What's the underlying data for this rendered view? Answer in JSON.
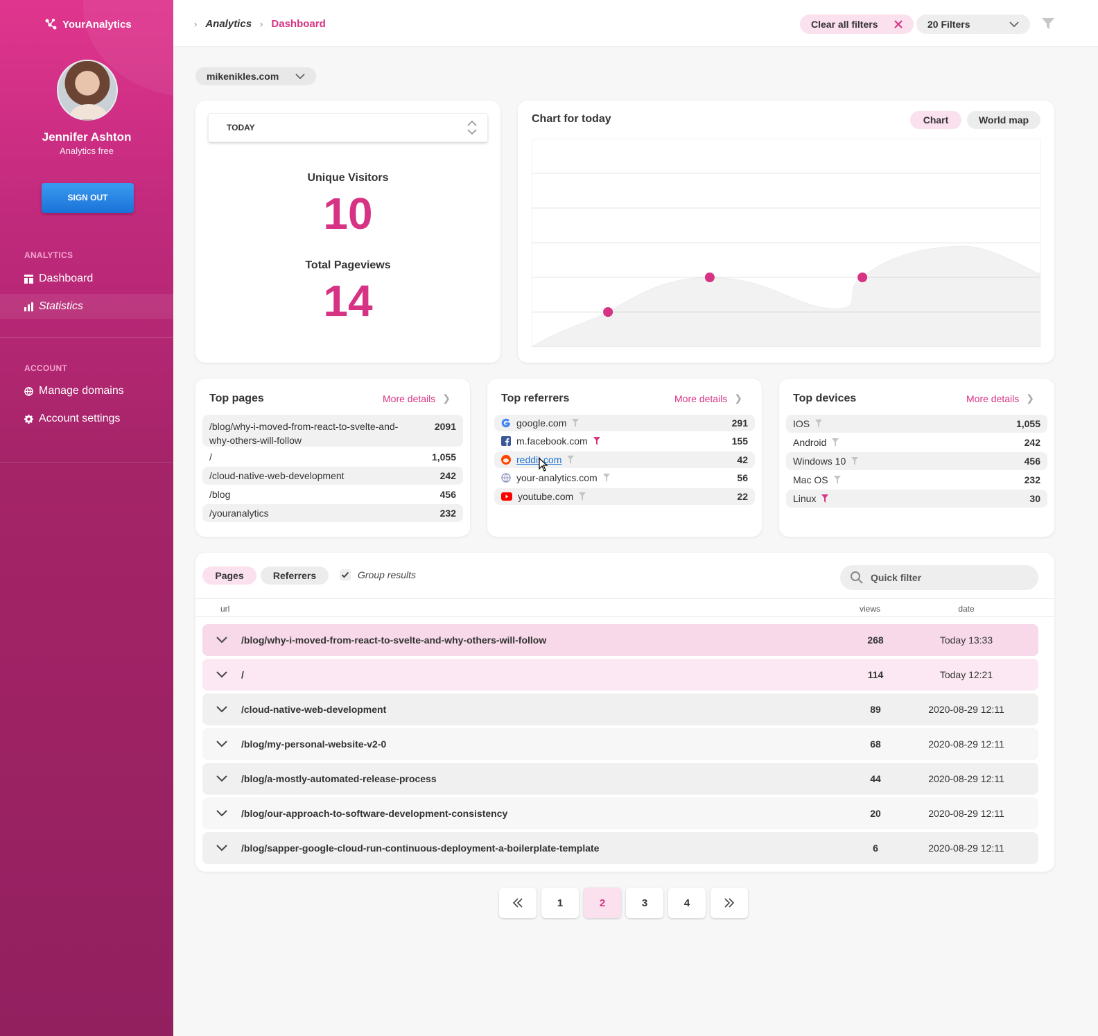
{
  "app": {
    "logo_text": "YourAnalytics"
  },
  "user": {
    "name": "Jennifer Ashton",
    "plan": "Analytics free",
    "signout_label": "SIGN OUT"
  },
  "sidebar": {
    "sections": [
      {
        "title": "ANALYTICS",
        "items": [
          {
            "label": "Dashboard",
            "icon": "dashboard-icon"
          },
          {
            "label": "Statistics",
            "icon": "bar-chart-icon",
            "active": true
          }
        ]
      },
      {
        "title": "ACCOUNT",
        "items": [
          {
            "label": "Manage domains",
            "icon": "globe-icon"
          },
          {
            "label": "Account settings",
            "icon": "gear-icon"
          }
        ]
      }
    ]
  },
  "breadcrumb": [
    "Analytics",
    "Dashboard"
  ],
  "header": {
    "clear_filters_label": "Clear all filters",
    "filters_label": "20 Filters"
  },
  "domain_select": {
    "value": "mikenikles.com"
  },
  "period_select": {
    "value": "TODAY"
  },
  "stats": {
    "unique_label": "Unique Visitors",
    "unique_value": "10",
    "pageviews_label": "Total Pageviews",
    "pageviews_value": "14"
  },
  "chart": {
    "title": "Chart for today",
    "tabs": [
      "Chart",
      "World map"
    ],
    "active_tab": "Chart"
  },
  "chart_data": {
    "type": "area",
    "points": [
      null,
      1,
      null,
      2,
      null,
      null,
      2,
      null,
      null,
      null
    ],
    "ylim": [
      0,
      6
    ],
    "grid": true
  },
  "top_pages": {
    "title": "Top pages",
    "more": "More details",
    "rows": [
      {
        "label": "/blog/why-i-moved-from-react-to-svelte-and-why-others-will-follow",
        "value": "2091"
      },
      {
        "label": "/",
        "value": "1,055"
      },
      {
        "label": "/cloud-native-web-development",
        "value": "242"
      },
      {
        "label": "/blog",
        "value": "456"
      },
      {
        "label": "/youranalytics",
        "value": "232"
      }
    ]
  },
  "top_referrers": {
    "title": "Top referrers",
    "more": "More details",
    "rows": [
      {
        "label": "google.com",
        "value": "291",
        "icon": "google-icon",
        "filter_active": false
      },
      {
        "label": "m.facebook.com",
        "value": "155",
        "icon": "facebook-icon",
        "filter_active": true
      },
      {
        "label": "reddit.com",
        "value": "42",
        "icon": "reddit-icon",
        "filter_active": false
      },
      {
        "label": "your-analytics.com",
        "value": "56",
        "icon": "globe-icon",
        "filter_active": false
      },
      {
        "label": "youtube.com",
        "value": "22",
        "icon": "youtube-icon",
        "filter_active": false
      }
    ]
  },
  "top_devices": {
    "title": "Top devices",
    "more": "More details",
    "rows": [
      {
        "label": "IOS",
        "value": "1,055",
        "filter_active": false
      },
      {
        "label": "Android",
        "value": "242",
        "filter_active": false
      },
      {
        "label": "Windows 10",
        "value": "456",
        "filter_active": false
      },
      {
        "label": "Mac OS",
        "value": "232",
        "filter_active": false
      },
      {
        "label": "Linux",
        "value": "30",
        "filter_active": true
      }
    ]
  },
  "table": {
    "tabs": [
      "Pages",
      "Referrers"
    ],
    "active_tab": "Pages",
    "group_label": "Group results",
    "group_checked": true,
    "search_placeholder": "Quick filter",
    "columns": [
      "url",
      "views",
      "date"
    ],
    "rows": [
      {
        "url": "/blog/why-i-moved-from-react-to-svelte-and-why-others-will-follow",
        "views": "268",
        "date": "Today 13:33"
      },
      {
        "url": "/",
        "views": "114",
        "date": "Today 12:21"
      },
      {
        "url": "/cloud-native-web-development",
        "views": "89",
        "date": "2020-08-29 12:11"
      },
      {
        "url": "/blog/my-personal-website-v2-0",
        "views": "68",
        "date": "2020-08-29 12:11"
      },
      {
        "url": "/blog/a-mostly-automated-release-process",
        "views": "44",
        "date": "2020-08-29 12:11"
      },
      {
        "url": "/blog/our-approach-to-software-development-consistency",
        "views": "20",
        "date": "2020-08-29 12:11"
      },
      {
        "url": "/blog/sapper-google-cloud-run-continuous-deployment-a-boilerplate-template",
        "views": "6",
        "date": "2020-08-29 12:11"
      }
    ]
  },
  "pagination": {
    "pages": [
      "1",
      "2",
      "3",
      "4"
    ],
    "current": "2",
    "first_icon": "double-chevron-left-icon",
    "last_icon": "double-chevron-right-icon"
  },
  "colors": {
    "accent": "#d63384",
    "accent_light": "#fbe0ee",
    "sidebar_top": "#e0358e",
    "sidebar_bottom": "#92205f",
    "signout": "#1a72d8"
  }
}
